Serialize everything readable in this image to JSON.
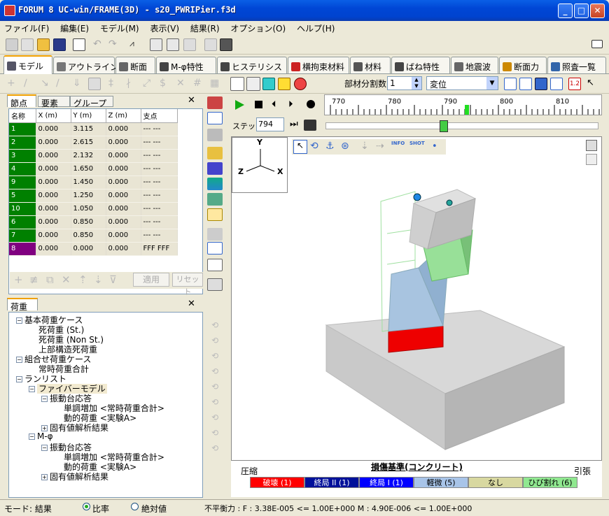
{
  "window": {
    "title": "FORUM 8   UC-win/FRAME(3D) - s20_PWRIPier.f3d"
  },
  "menu": [
    "ファイル(F)",
    "編集(E)",
    "モデル(M)",
    "表示(V)",
    "結果(R)",
    "オプション(O)",
    "ヘルプ(H)"
  ],
  "tabs": [
    "モデル",
    "アウトライン",
    "断面",
    "M-φ特性",
    "ヒステリシス",
    "横拘束材料",
    "材料",
    "ばね特性",
    "地震波",
    "断面力",
    "照査一覧"
  ],
  "toolbar2": {
    "member_div_label": "部材分割数",
    "member_div_value": "1",
    "display_value": "変位",
    "zoom_label": "1.2"
  },
  "left_panel": {
    "tabs": [
      "節点",
      "要素",
      "グループ"
    ],
    "columns": [
      "名称",
      "X (m)",
      "Y (m)",
      "Z (m)",
      "支点"
    ],
    "rows": [
      [
        "1",
        "0.000",
        "3.115",
        "0.000",
        "--- ---"
      ],
      [
        "2",
        "0.000",
        "2.615",
        "0.000",
        "--- ---"
      ],
      [
        "3",
        "0.000",
        "2.132",
        "0.000",
        "--- ---"
      ],
      [
        "4",
        "0.000",
        "1.650",
        "0.000",
        "--- ---"
      ],
      [
        "9",
        "0.000",
        "1.450",
        "0.000",
        "--- ---"
      ],
      [
        "5",
        "0.000",
        "1.250",
        "0.000",
        "--- ---"
      ],
      [
        "10",
        "0.000",
        "1.050",
        "0.000",
        "--- ---"
      ],
      [
        "6",
        "0.000",
        "0.850",
        "0.000",
        "--- ---"
      ],
      [
        "7",
        "0.000",
        "0.850",
        "0.000",
        "--- ---"
      ],
      [
        "8",
        "0.000",
        "0.000",
        "0.000",
        "FFF FFF"
      ]
    ],
    "apply_label": "適用",
    "reset_label": "リセット"
  },
  "load_panel": {
    "tab": "荷重",
    "tree": [
      {
        "label": "基本荷重ケース",
        "level": 0,
        "toggle": "-"
      },
      {
        "label": "死荷重 (St.)",
        "level": 1
      },
      {
        "label": "死荷重 (Non St.)",
        "level": 1
      },
      {
        "label": "上部構造死荷重",
        "level": 1
      },
      {
        "label": "組合せ荷重ケース",
        "level": 0,
        "toggle": "-"
      },
      {
        "label": "常時荷重合計",
        "level": 1
      },
      {
        "label": "ランリスト",
        "level": 0,
        "toggle": "-"
      },
      {
        "label": "ファイバーモデル",
        "level": 1,
        "toggle": "-",
        "selected": true
      },
      {
        "label": "振動台応答",
        "level": 2,
        "toggle": "-"
      },
      {
        "label": "単調増加 <常時荷重合計>",
        "level": 3
      },
      {
        "label": "動的荷重 <実験A>",
        "level": 3
      },
      {
        "label": "固有値解析結果",
        "level": 2,
        "toggle": "+"
      },
      {
        "label": "M-φ",
        "level": 1,
        "toggle": "-"
      },
      {
        "label": "振動台応答",
        "level": 2,
        "toggle": "-"
      },
      {
        "label": "単調増加 <常時荷重合計>",
        "level": 3
      },
      {
        "label": "動的荷重 <実験A>",
        "level": 3
      },
      {
        "label": "固有値解析結果",
        "level": 2,
        "toggle": "+"
      }
    ]
  },
  "timeline": {
    "ticks": [
      "770",
      "780",
      "790",
      "800",
      "810"
    ],
    "step_label": "ステップ",
    "step_value": "794",
    "slider_fraction": 0.43
  },
  "view": {
    "axes": {
      "y": "Y",
      "z": "Z",
      "x": "X"
    },
    "info_label": "INFO",
    "shot_label": "SHOT"
  },
  "legend": {
    "title": "損傷基準(コンクリート)",
    "left": "圧縮",
    "right": "引張",
    "items": [
      {
        "label": "破壊 (1)",
        "color": "#ff0000",
        "text": "#ffffff"
      },
      {
        "label": "終局 II (1)",
        "color": "#00109a",
        "text": "#ffffff"
      },
      {
        "label": "終局 I (1)",
        "color": "#0000ff",
        "text": "#ffffff"
      },
      {
        "label": "軽微 (5)",
        "color": "#a8c4e8",
        "text": "#000000"
      },
      {
        "label": "なし",
        "color": "#d8d8a0",
        "text": "#000000"
      },
      {
        "label": "ひび割れ (6)",
        "color": "#90e890",
        "text": "#000000"
      }
    ]
  },
  "statusbar": {
    "mode_label": "モード: 結果",
    "ratio_label": "比率",
    "absolute_label": "絶対値",
    "unbalance": "不平衡力 : F : 3.38E-005 <= 1.00E+000  M : 4.90E-006 <= 1.00E+000"
  }
}
